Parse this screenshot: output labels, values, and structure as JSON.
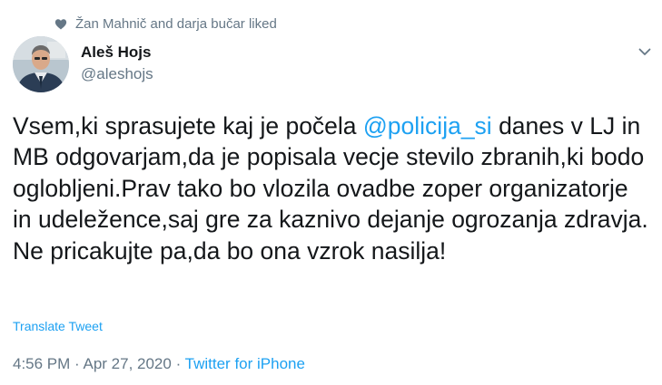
{
  "social_context": {
    "icon": "heart-icon",
    "text": "Žan Mahnič and darja bučar liked"
  },
  "author": {
    "display_name": "Aleš Hojs",
    "handle": "@aleshojs"
  },
  "tweet": {
    "text_part1": "Vsem,ki sprasujete kaj je počela ",
    "mention": "@policija_si",
    "text_part2": " danes v LJ in MB odgovarjam,da je popisala vecje stevilo zbranih,ki bodo oglobljeni.Prav tako bo vlozila ovadbe zoper organizatorje in udeležence,saj gre za kaznivo dejanje ogrozanja zdravja. Ne pricakujte pa,da bo ona vzrok nasilja!"
  },
  "translate_label": "Translate Tweet",
  "meta": {
    "time": "4:56 PM",
    "separator1": " · ",
    "date": "Apr 27, 2020",
    "separator2": " · ",
    "source": "Twitter for iPhone"
  },
  "colors": {
    "link": "#1da1f2",
    "secondary_text": "#657786",
    "primary_text": "#14171a"
  }
}
